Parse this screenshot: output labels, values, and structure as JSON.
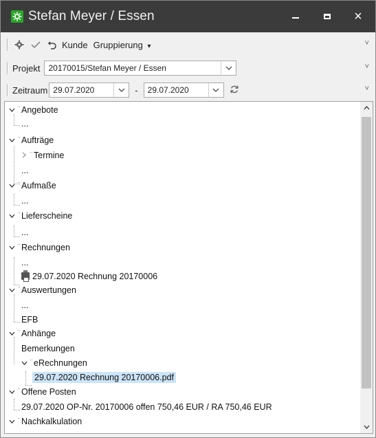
{
  "window": {
    "title": "Stefan Meyer / Essen",
    "minimize_icon": "minimize-icon",
    "maximize_icon": "maximize-icon",
    "close_label": "×"
  },
  "toolbar": {
    "kunde_label": "Kunde",
    "gruppierung_label": "Gruppierung",
    "gruppierung_arrow": "▾",
    "overflow": "˅"
  },
  "projekt": {
    "label": "Projekt",
    "value": "20170015/Stefan Meyer / Essen"
  },
  "zeitraum": {
    "label": "Zeitraum",
    "from": "29.07.2020",
    "dash": "-",
    "to": "29.07.2020"
  },
  "tree": {
    "angebote": "Angebote",
    "angebote_child": "...",
    "auftraege": "Aufträge",
    "termine": "Termine",
    "auftraege_child": "...",
    "aufmasse": "Aufmaße",
    "aufmasse_child": "...",
    "lieferscheine": "Lieferscheine",
    "lieferscheine_child": "...",
    "rechnungen": "Rechnungen",
    "rechnungen_child": "...",
    "rechnung_item": "29.07.2020 Rechnung 20170006",
    "auswertungen": "Auswertungen",
    "auswertungen_child": "...",
    "efb": "EFB",
    "anhaenge": "Anhänge",
    "bemerkungen": "Bemerkungen",
    "erechnungen": "eRechnungen",
    "erechnung_pdf": "29.07.2020 Rechnung 20170006.pdf",
    "offene_posten": "Offene Posten",
    "op_item": "29.07.2020 OP-Nr. 20170006 offen 750,46 EUR / RA 750,46 EUR",
    "nachkalkulation": "Nachkalkulation"
  },
  "colors": {
    "titlebar": "#3b3b3b",
    "app_icon": "#2aa62a",
    "selection": "#cce4f7"
  }
}
